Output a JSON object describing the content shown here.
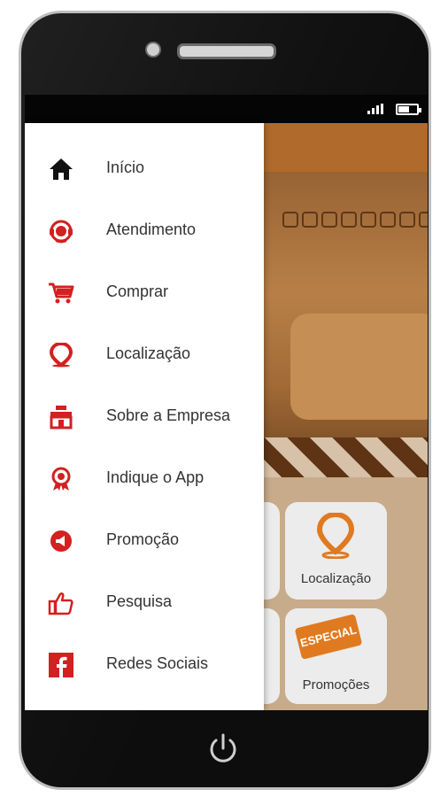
{
  "colors": {
    "accent": "#d32020",
    "header": "#b06a2c",
    "text": "#333333"
  },
  "drawer": {
    "items": [
      {
        "label": "Início",
        "icon": "home-icon"
      },
      {
        "label": "Atendimento",
        "icon": "support-agent-icon"
      },
      {
        "label": "Comprar",
        "icon": "cart-icon"
      },
      {
        "label": "Localização",
        "icon": "location-pin-icon"
      },
      {
        "label": "Sobre a Empresa",
        "icon": "store-icon"
      },
      {
        "label": "Indique o App",
        "icon": "award-ribbon-icon"
      },
      {
        "label": "Promoção",
        "icon": "megaphone-icon"
      },
      {
        "label": "Pesquisa",
        "icon": "thumbs-up-icon"
      },
      {
        "label": "Redes Sociais",
        "icon": "facebook-icon"
      }
    ]
  },
  "home_grid": {
    "localizacao_label": "Localização",
    "promocoes_label": "Promoções",
    "especial_badge": "ESPECIAL"
  }
}
